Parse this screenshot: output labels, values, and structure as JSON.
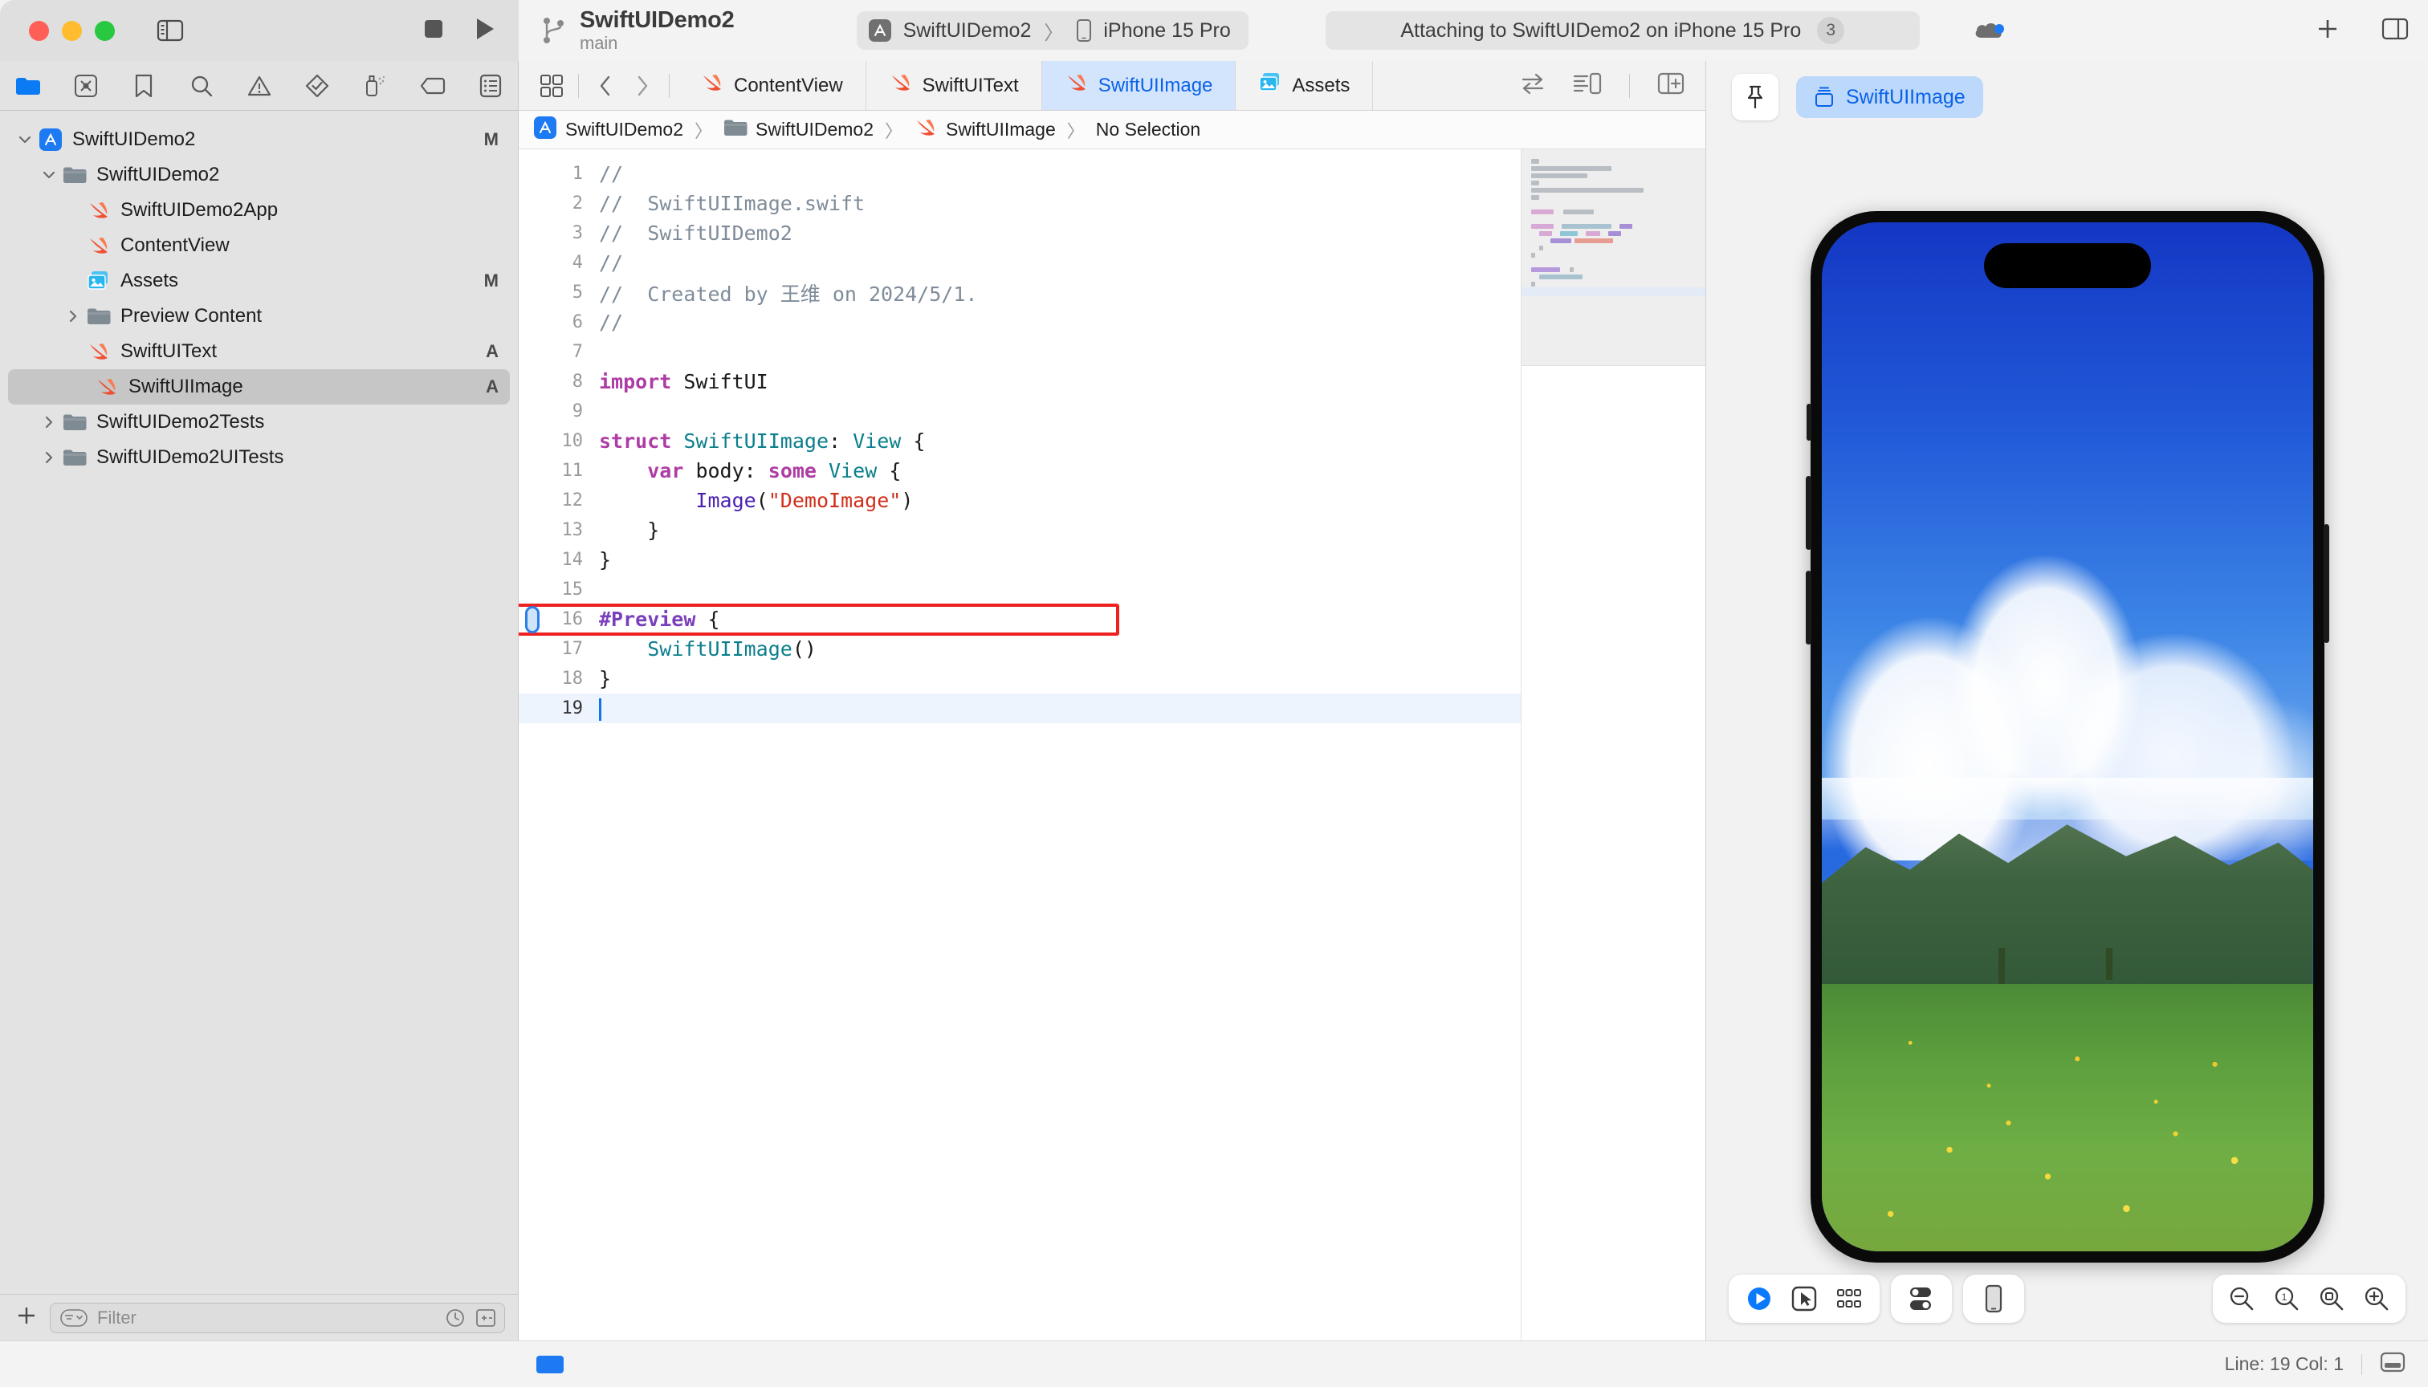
{
  "window": {
    "traffic_lights": [
      "close",
      "minimize",
      "zoom"
    ],
    "project_title": "SwiftUIDemo2",
    "branch": "main",
    "scheme": "SwiftUIDemo2",
    "destination": "iPhone 15 Pro",
    "status_message": "Attaching to SwiftUIDemo2 on iPhone 15 Pro",
    "status_count": "3",
    "separator": "〉"
  },
  "navigator": {
    "tabs": [
      {
        "name": "project-navigator",
        "icon": "folder-icon",
        "active": true
      },
      {
        "name": "source-control-navigator",
        "icon": "source-control-icon",
        "active": false
      },
      {
        "name": "bookmark-navigator",
        "icon": "bookmark-icon",
        "active": false
      },
      {
        "name": "find-navigator",
        "icon": "search-icon",
        "active": false
      },
      {
        "name": "issue-navigator",
        "icon": "warning-icon",
        "active": false
      },
      {
        "name": "test-navigator",
        "icon": "diamond-check-icon",
        "active": false
      },
      {
        "name": "debug-navigator",
        "icon": "spray-icon",
        "active": false
      },
      {
        "name": "breakpoint-navigator",
        "icon": "tag-icon",
        "active": false
      },
      {
        "name": "report-navigator",
        "icon": "report-icon",
        "active": false
      }
    ],
    "items": [
      {
        "label": "SwiftUIDemo2",
        "icon": "xcode-project-icon",
        "indent": 0,
        "twisty": "down",
        "status": "M",
        "selected": false
      },
      {
        "label": "SwiftUIDemo2",
        "icon": "folder-icon",
        "indent": 1,
        "twisty": "down",
        "status": "",
        "selected": false
      },
      {
        "label": "SwiftUIDemo2App",
        "icon": "swift-icon",
        "indent": 2,
        "twisty": "",
        "status": "",
        "selected": false
      },
      {
        "label": "ContentView",
        "icon": "swift-icon",
        "indent": 2,
        "twisty": "",
        "status": "",
        "selected": false
      },
      {
        "label": "Assets",
        "icon": "assets-icon",
        "indent": 2,
        "twisty": "",
        "status": "M",
        "selected": false
      },
      {
        "label": "Preview Content",
        "icon": "folder-icon",
        "indent": 2,
        "twisty": "right",
        "status": "",
        "selected": false
      },
      {
        "label": "SwiftUIText",
        "icon": "swift-icon",
        "indent": 2,
        "twisty": "",
        "status": "A",
        "selected": false
      },
      {
        "label": "SwiftUIImage",
        "icon": "swift-icon",
        "indent": 2,
        "twisty": "",
        "status": "A",
        "selected": true
      },
      {
        "label": "SwiftUIDemo2Tests",
        "icon": "folder-icon",
        "indent": 1,
        "twisty": "right",
        "status": "",
        "selected": false
      },
      {
        "label": "SwiftUIDemo2UITests",
        "icon": "folder-icon",
        "indent": 1,
        "twisty": "right",
        "status": "",
        "selected": false
      }
    ],
    "filter_placeholder": "Filter",
    "add_button": "+"
  },
  "editor": {
    "tabs": [
      {
        "label": "ContentView",
        "icon": "swift-icon",
        "active": false
      },
      {
        "label": "SwiftUIText",
        "icon": "swift-icon",
        "active": false
      },
      {
        "label": "SwiftUIImage",
        "icon": "swift-icon",
        "active": true
      },
      {
        "label": "Assets",
        "icon": "assets-icon",
        "active": false
      }
    ],
    "breadcrumb": [
      {
        "label": "SwiftUIDemo2",
        "icon": "xcode-project-icon"
      },
      {
        "label": "SwiftUIDemo2",
        "icon": "folder-icon"
      },
      {
        "label": "SwiftUIImage",
        "icon": "swift-icon"
      },
      {
        "label": "No Selection",
        "icon": ""
      }
    ],
    "code_lines": [
      {
        "n": "1",
        "html": "<span class='cmt'>//</span>"
      },
      {
        "n": "2",
        "html": "<span class='cmt'>//  SwiftUIImage.swift</span>"
      },
      {
        "n": "3",
        "html": "<span class='cmt'>//  SwiftUIDemo2</span>"
      },
      {
        "n": "4",
        "html": "<span class='cmt'>//</span>"
      },
      {
        "n": "5",
        "html": "<span class='cmt'>//  Created by 王维 on 2024/5/1.</span>"
      },
      {
        "n": "6",
        "html": "<span class='cmt'>//</span>"
      },
      {
        "n": "7",
        "html": ""
      },
      {
        "n": "8",
        "html": "<span class='kw'>import</span> <span class='id'>SwiftUI</span>"
      },
      {
        "n": "9",
        "html": ""
      },
      {
        "n": "10",
        "html": "<span class='kw'>struct</span> <span class='typ'>SwiftUIImage</span><span class='id'>: </span><span class='typ'>View</span> <span class='id'>{</span>"
      },
      {
        "n": "11",
        "html": "    <span class='kw'>var</span> <span class='id'>body</span><span class='id'>: </span><span class='kw'>some</span> <span class='typ'>View</span> <span class='id'>{</span>"
      },
      {
        "n": "12",
        "html": "        <span class='fn'>Image</span><span class='id'>(</span><span class='str'>\"DemoImage\"</span><span class='id'>)</span>"
      },
      {
        "n": "13",
        "html": "    <span class='id'>}</span>"
      },
      {
        "n": "14",
        "html": "<span class='id'>}</span>"
      },
      {
        "n": "15",
        "html": ""
      },
      {
        "n": "16",
        "html": "<span class='prep'>#Preview</span> <span class='id'>{</span>"
      },
      {
        "n": "17",
        "html": "    <span class='typ'>SwiftUIImage</span><span class='id'>()</span>"
      },
      {
        "n": "18",
        "html": "<span class='id'>}</span>"
      },
      {
        "n": "19",
        "html": "<span class='caret'></span>",
        "current": true
      }
    ],
    "highlighted_line": "12",
    "breakpoint_line": "12"
  },
  "preview": {
    "pin_button": "pin-icon",
    "chip_label": "SwiftUIImage",
    "device": "iPhone 15 Pro",
    "toolbar": [
      {
        "name": "live-preview-button",
        "icon": "play-circle-icon"
      },
      {
        "name": "selectable-preview-button",
        "icon": "cursor-select-icon"
      },
      {
        "name": "variants-button",
        "icon": "grid-variants-icon"
      },
      {
        "name": "device-settings-button",
        "icon": "toggles-icon"
      },
      {
        "name": "device-button",
        "icon": "phone-icon"
      }
    ],
    "zoom_controls": [
      {
        "name": "zoom-out-button",
        "icon": "zoom-out-icon"
      },
      {
        "name": "zoom-actual-button",
        "icon": "zoom-1x-icon"
      },
      {
        "name": "zoom-fit-button",
        "icon": "zoom-fit-icon"
      },
      {
        "name": "zoom-in-button",
        "icon": "zoom-in-icon"
      }
    ]
  },
  "statusbar": {
    "line_col": "Line: 19  Col: 1",
    "console_toggle": "console-toggle-icon"
  }
}
